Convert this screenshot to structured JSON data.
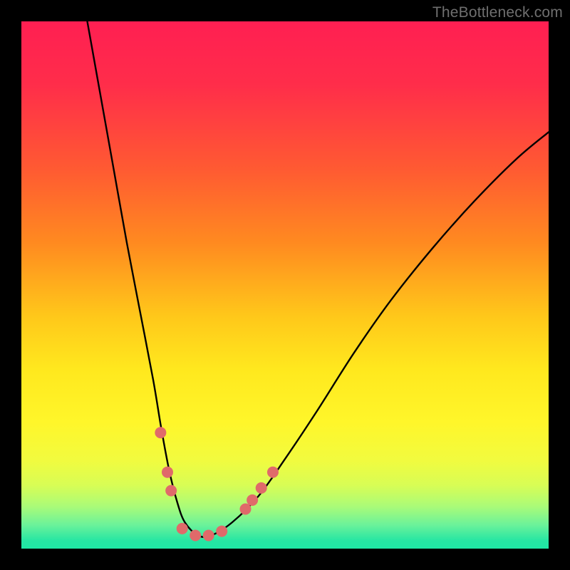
{
  "watermark": "TheBottleneck.com",
  "gradient_stops": [
    {
      "offset": 0.0,
      "color": "#ff1f52"
    },
    {
      "offset": 0.12,
      "color": "#ff2d4a"
    },
    {
      "offset": 0.28,
      "color": "#ff5a32"
    },
    {
      "offset": 0.42,
      "color": "#ff8a20"
    },
    {
      "offset": 0.56,
      "color": "#ffc81a"
    },
    {
      "offset": 0.66,
      "color": "#ffe81e"
    },
    {
      "offset": 0.76,
      "color": "#fff62a"
    },
    {
      "offset": 0.83,
      "color": "#f2fb3e"
    },
    {
      "offset": 0.88,
      "color": "#d8fd55"
    },
    {
      "offset": 0.92,
      "color": "#aafb78"
    },
    {
      "offset": 0.955,
      "color": "#6bf29a"
    },
    {
      "offset": 0.985,
      "color": "#26e6a3"
    },
    {
      "offset": 1.0,
      "color": "#1fe7a4"
    }
  ],
  "chart_data": {
    "type": "line",
    "title": "",
    "xlabel": "",
    "ylabel": "",
    "xlim": [
      0,
      100
    ],
    "ylim": [
      0,
      100
    ],
    "series": [
      {
        "name": "bottleneck-curve",
        "x": [
          12.5,
          15,
          17.5,
          20,
          22.5,
          25,
          26.5,
          28,
          29.5,
          31,
          33.5,
          36,
          40,
          45,
          50,
          56,
          63,
          70,
          78,
          86,
          94,
          100
        ],
        "y": [
          100,
          86,
          72,
          58,
          45,
          32,
          23,
          15,
          9,
          5,
          2.5,
          2.5,
          5,
          10,
          17,
          26,
          37,
          47,
          57,
          66,
          74,
          79
        ]
      }
    ],
    "markers": [
      {
        "x": 26.4,
        "y": 22.0
      },
      {
        "x": 27.7,
        "y": 14.5
      },
      {
        "x": 28.4,
        "y": 11.0
      },
      {
        "x": 30.5,
        "y": 3.8
      },
      {
        "x": 33.0,
        "y": 2.5
      },
      {
        "x": 35.5,
        "y": 2.5
      },
      {
        "x": 38.0,
        "y": 3.3
      },
      {
        "x": 42.5,
        "y": 7.5
      },
      {
        "x": 43.8,
        "y": 9.2
      },
      {
        "x": 45.5,
        "y": 11.5
      },
      {
        "x": 47.7,
        "y": 14.5
      }
    ],
    "marker_style": {
      "color": "#e06a6a",
      "radius_px": 8
    }
  }
}
